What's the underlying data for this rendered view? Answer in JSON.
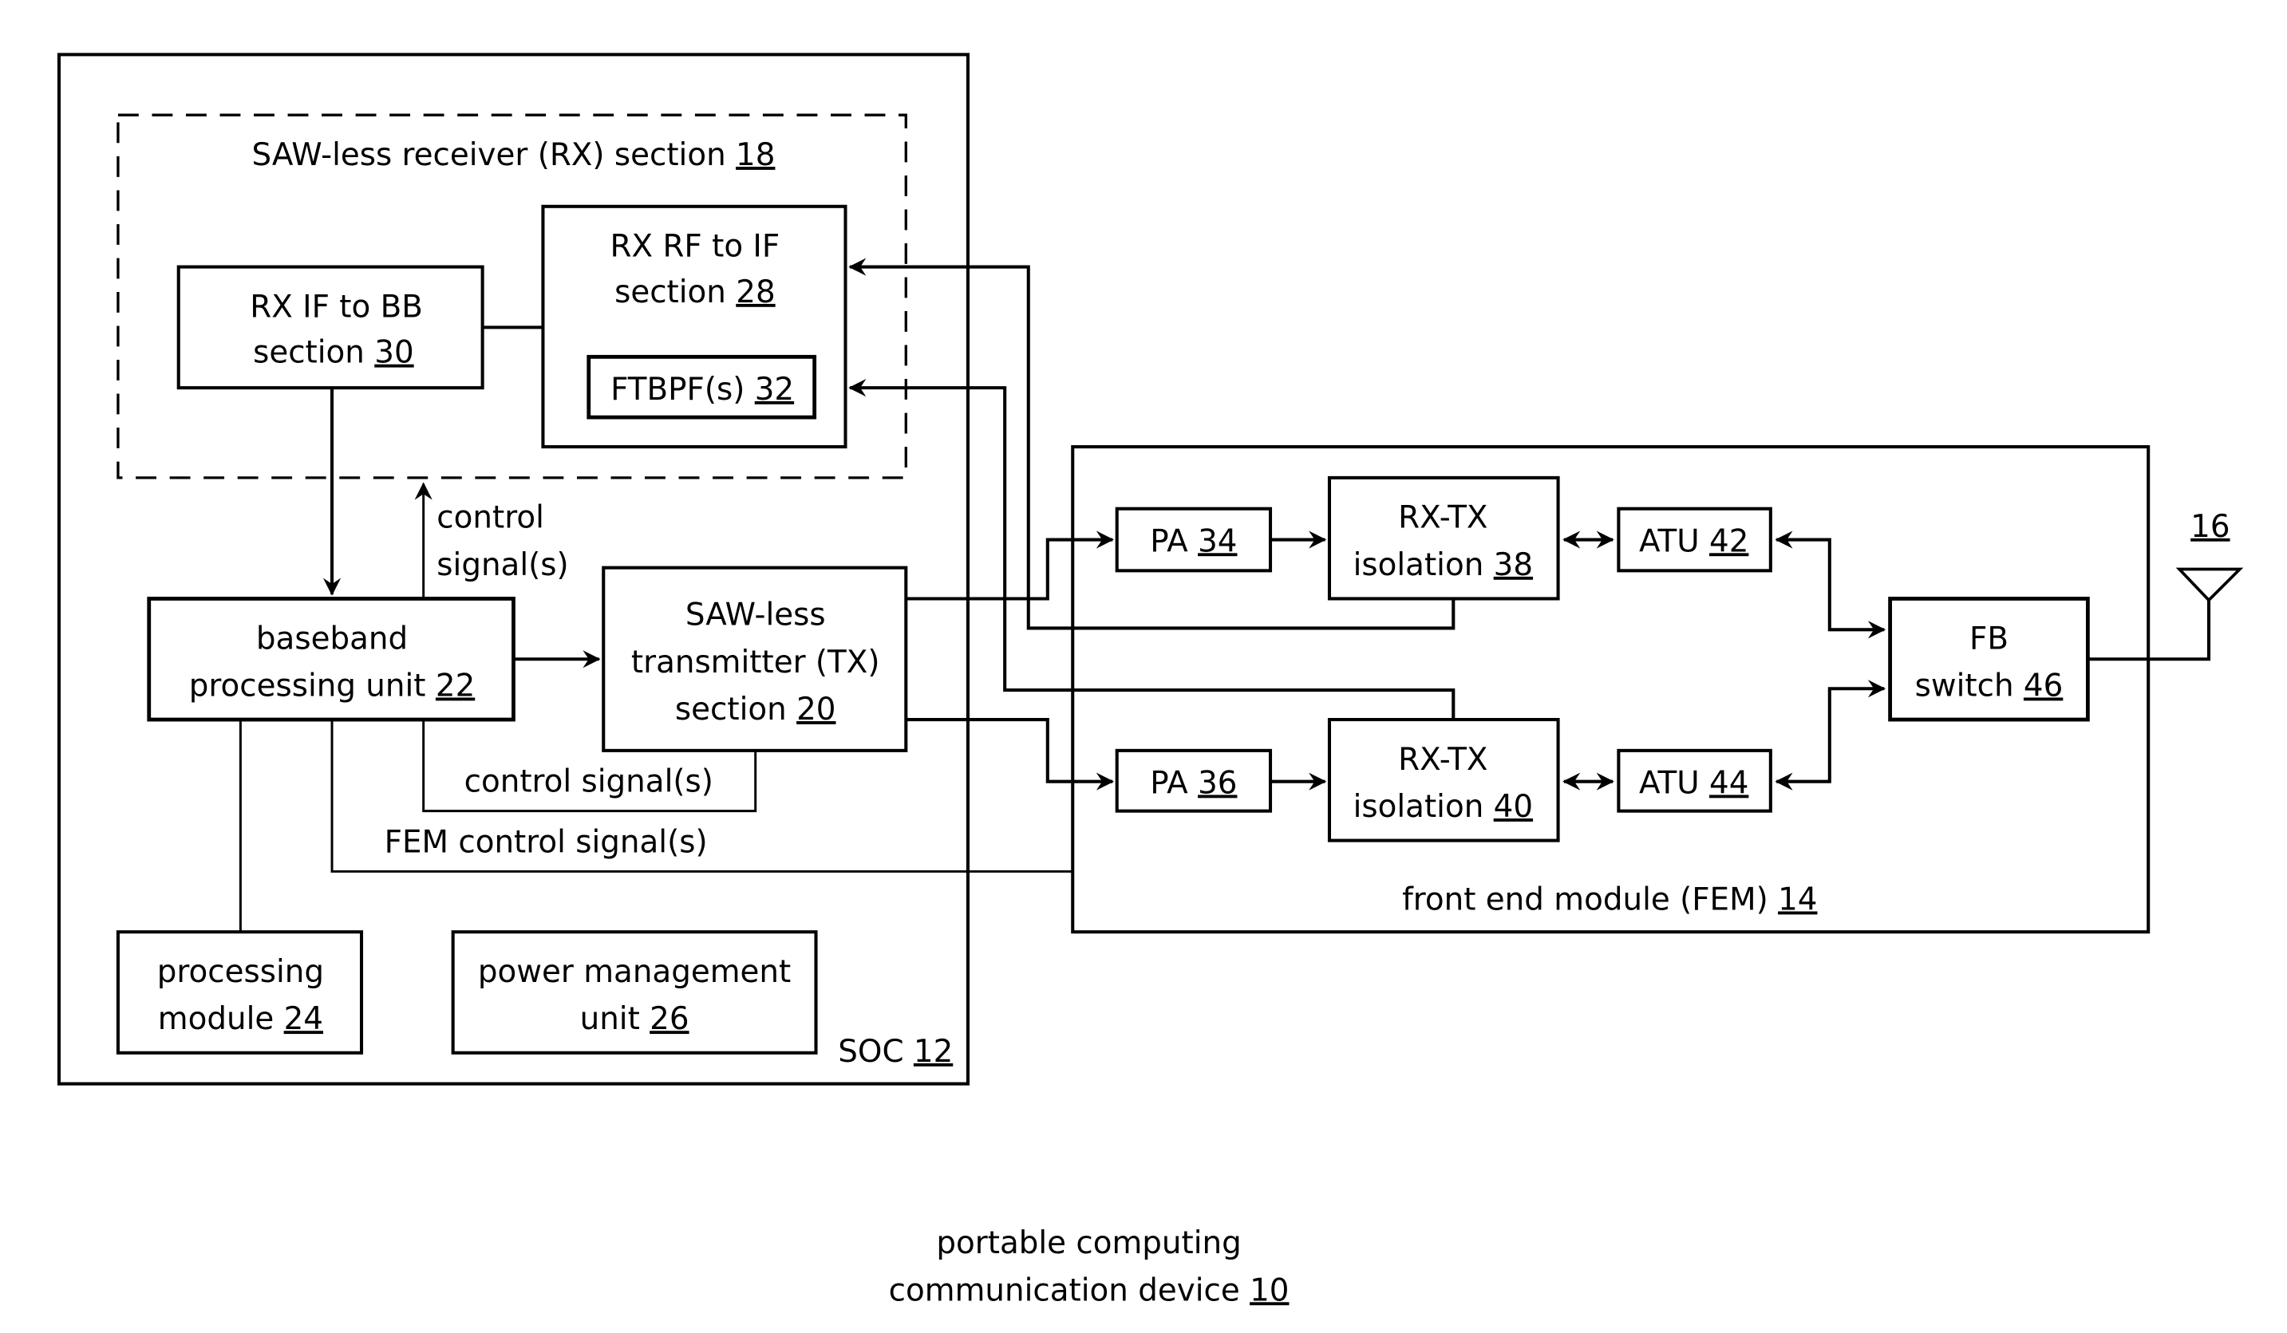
{
  "figure": {
    "caption": {
      "line1": "portable computing",
      "line2_text": "communication device ",
      "line2_ref": "10"
    }
  },
  "soc": {
    "label_text": "SOC ",
    "ref": "12"
  },
  "rx_section": {
    "label_text": "SAW-less receiver (RX) section ",
    "ref": "18"
  },
  "blocks": {
    "rx_if_bb": {
      "line1": "RX IF to BB",
      "line2_text": "section ",
      "ref": "30"
    },
    "rx_rf_if": {
      "line1": "RX RF to IF",
      "line2_text": "section ",
      "ref": "28"
    },
    "ftbpf": {
      "label_text": "FTBPF(s) ",
      "ref": "32"
    },
    "baseband": {
      "line1": "baseband",
      "line2_text": "processing unit ",
      "ref": "22"
    },
    "tx_section": {
      "line1": "SAW-less",
      "line2": "transmitter (TX)",
      "line3_text": "section ",
      "ref": "20"
    },
    "processing_module": {
      "line1": "processing",
      "line2_text": "module ",
      "ref": "24"
    },
    "power_mgmt": {
      "line1": "power management",
      "line2_text": "unit ",
      "ref": "26"
    },
    "pa_34": {
      "label_text": "PA ",
      "ref": "34"
    },
    "pa_36": {
      "label_text": "PA ",
      "ref": "36"
    },
    "rxtx_38": {
      "line1": "RX-TX",
      "line2_text": "isolation ",
      "ref": "38"
    },
    "rxtx_40": {
      "line1": "RX-TX",
      "line2_text": "isolation ",
      "ref": "40"
    },
    "atu_42": {
      "label_text": "ATU ",
      "ref": "42"
    },
    "atu_44": {
      "label_text": "ATU ",
      "ref": "44"
    },
    "fb_switch": {
      "line1": "FB",
      "line2_text": "switch ",
      "ref": "46"
    }
  },
  "fem": {
    "label_text": "front end module (FEM) ",
    "ref": "14"
  },
  "antenna": {
    "ref": "16"
  },
  "signals": {
    "control_rx_line1": "control",
    "control_rx_line2": "signal(s)",
    "control_tx": "control signal(s)",
    "fem_control": "FEM control signal(s)"
  }
}
